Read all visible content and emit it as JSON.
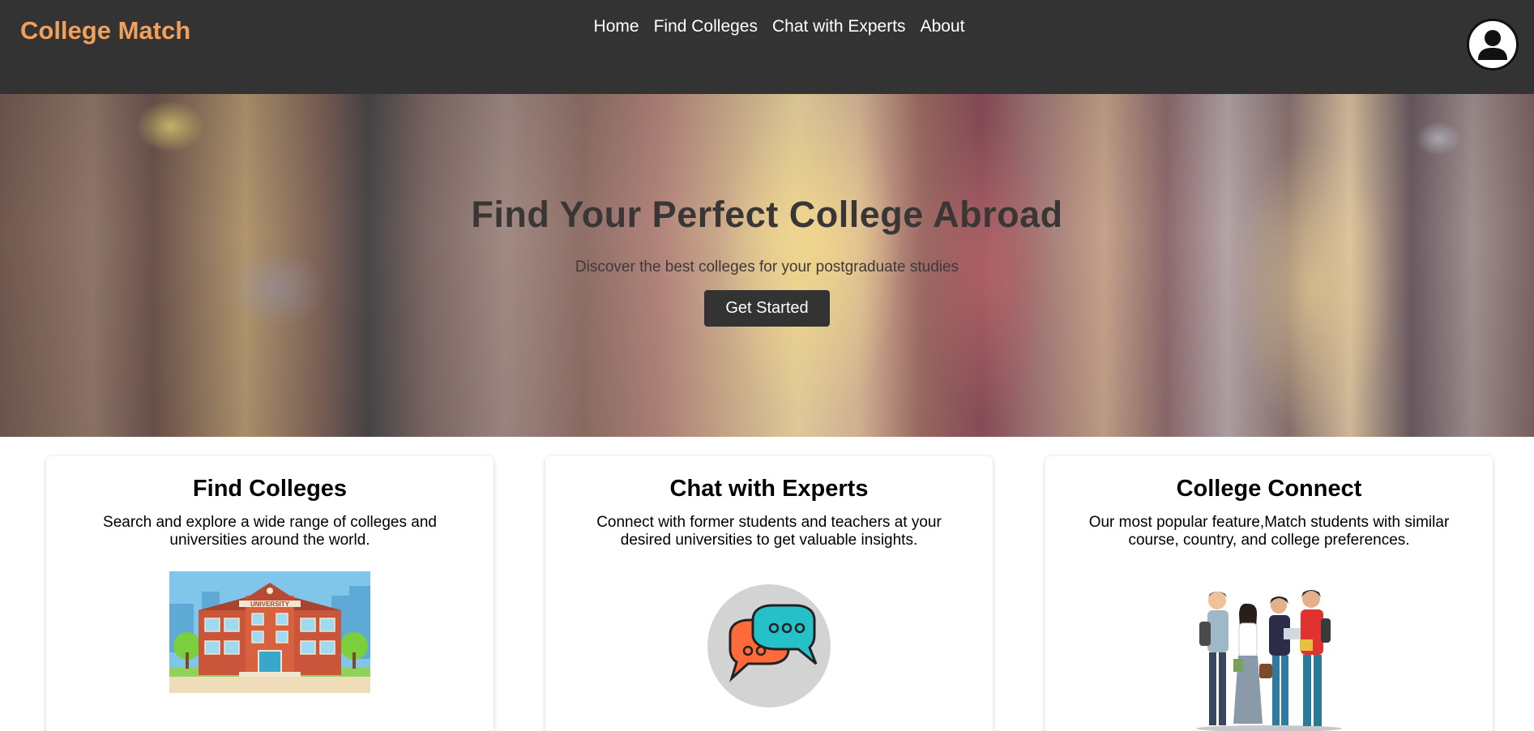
{
  "brand": {
    "name": "College Match"
  },
  "nav": {
    "links": [
      "Home",
      "Find Colleges",
      "Chat with Experts",
      "About"
    ]
  },
  "profile": {
    "icon": "user-avatar-icon"
  },
  "hero": {
    "title": "Find Your Perfect College Abroad",
    "subtitle": "Discover the best colleges for your postgraduate studies",
    "button_label": "Get Started"
  },
  "cards": [
    {
      "title": "Find Colleges",
      "description": "Search and explore a wide range of colleges and universities around the world.",
      "image": "university-building-illustration",
      "image_label": "UNIVERSITY"
    },
    {
      "title": "Chat with Experts",
      "description": "Connect with former students and teachers at your desired universities to get valuable insights.",
      "image": "chat-bubbles-icon"
    },
    {
      "title": "College Connect",
      "description": "Our most popular feature,Match students with similar course, country, and college preferences.",
      "image": "students-group-illustration"
    }
  ],
  "colors": {
    "navbar": "#333333",
    "brand": "#f0a05a",
    "button": "#333333"
  }
}
